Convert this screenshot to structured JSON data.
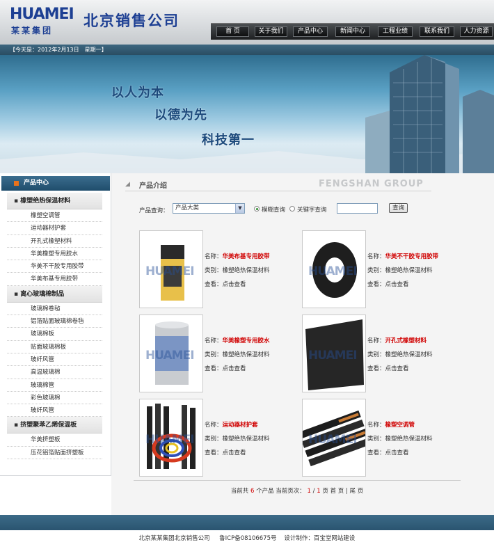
{
  "header": {
    "logo_main": "HUAMEI",
    "logo_sub": "某某集团",
    "company_name": "北京销售公司",
    "nav": [
      "首  页",
      "关于我们",
      "产品中心",
      "新闻中心",
      "工程业绩",
      "联系我们",
      "人力资源"
    ]
  },
  "date_bar": "【今天是：2012年2月13日　星期一】",
  "banner": {
    "slogans": [
      "以人为本",
      "以德为先",
      "科技第一"
    ]
  },
  "sidebar": {
    "title": "产品中心",
    "categories": [
      {
        "name": "橡塑绝热保温材料",
        "items": [
          "橡塑空调管",
          "运动器材护套",
          "开孔式橡塑材料",
          "华美橡塑专用胶水",
          "华美不干胶专用胶带",
          "华美布基专用胶带"
        ]
      },
      {
        "name": "离心玻璃棉制品",
        "items": [
          "玻璃棉卷毡",
          "铝箔贴面玻璃棉卷毡",
          "玻璃棉板",
          "贴面玻璃棉板",
          "玻纤风管",
          "高温玻璃棉",
          "玻璃棉管",
          "彩色玻璃棉",
          "玻纤风管"
        ]
      },
      {
        "name": "挤塑聚苯乙烯保温板",
        "items": [
          "华美挤塑板",
          "压花铝箔贴面挤塑板"
        ]
      }
    ]
  },
  "main": {
    "title": "产品介绍",
    "title_en": "FENGSHAN GROUP",
    "search": {
      "label": "产品查询：",
      "select_value": "产品大类",
      "radio_fuzzy": "模糊查询",
      "radio_keyword": "关键字查询",
      "button": "查询"
    },
    "field_labels": {
      "name": "名称：",
      "type": "类别：",
      "view": "查看："
    },
    "products": [
      {
        "name": "华美布基专用胶带",
        "type": "橡塑绝热保温材料",
        "view": "点击查看"
      },
      {
        "name": "华美不干胶专用胶带",
        "type": "橡塑绝热保温材料",
        "view": "点击查看"
      },
      {
        "name": "华美橡塑专用胶水",
        "type": "橡塑绝热保温材料",
        "view": "点击查看"
      },
      {
        "name": "开孔式橡塑材料",
        "type": "橡塑绝热保温材料",
        "view": "点击查看"
      },
      {
        "name": "运动器材护套",
        "type": "橡塑绝热保温材料",
        "view": "点击查看"
      },
      {
        "name": "橡塑空调管",
        "type": "橡塑绝热保温材料",
        "view": "点击查看"
      }
    ],
    "watermark": "HUAMEI",
    "pager": {
      "total_prefix": "当前共",
      "total": "6",
      "total_suffix": "个产品 当前页次：",
      "current": "1",
      "sep": "/",
      "pages": "1",
      "page_word": "页",
      "first": "首 页",
      "divider": "|",
      "last": "尾 页"
    }
  },
  "footer": {
    "company": "北京某某集团北京销售公司",
    "icp": "鲁ICP备08106675号",
    "design": "设计制作：百宝堂网站建设"
  },
  "colors": {
    "brand_blue": "#1d3f93",
    "accent_red": "#d00000",
    "bar_blue": "#2a5470"
  }
}
